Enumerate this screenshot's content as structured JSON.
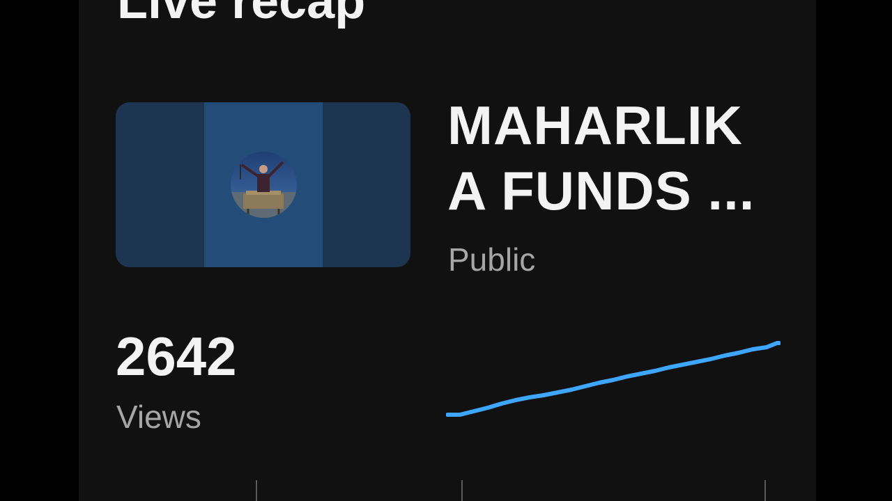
{
  "header": {
    "title": "Live recap"
  },
  "video": {
    "title_line1": "MAHARLIK",
    "title_line2": "A FUNDS ...",
    "visibility": "Public",
    "thumbnail": {
      "avatar_icon": "profile-avatar",
      "bg_color": "#1e3552",
      "center_color": "#234d78"
    }
  },
  "stats": {
    "views_count": "2642",
    "views_label": "Views"
  },
  "colors": {
    "background": "#111111",
    "text_primary": "#f3f3f3",
    "text_secondary": "#a6a6a6",
    "accent": "#3ea6ff"
  }
}
